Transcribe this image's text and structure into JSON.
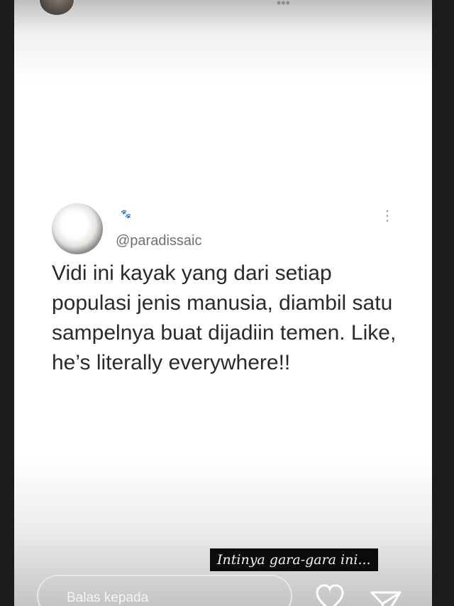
{
  "story": {
    "username": "",
    "reply_placeholder": "Balas kepada",
    "caption": "Intinya gara-gara ini..."
  },
  "tweet": {
    "handle": "@paradissaic",
    "name_icon": "🐾",
    "text": "Vidi ini kayak yang dari setiap populasi jenis manusia, diambil satu sampelnya buat dijadiin temen. Like, he’s literally everywhere!!"
  },
  "icons": {
    "heart": "heart-icon",
    "send": "send-icon",
    "more": "more-vertical-icon"
  }
}
